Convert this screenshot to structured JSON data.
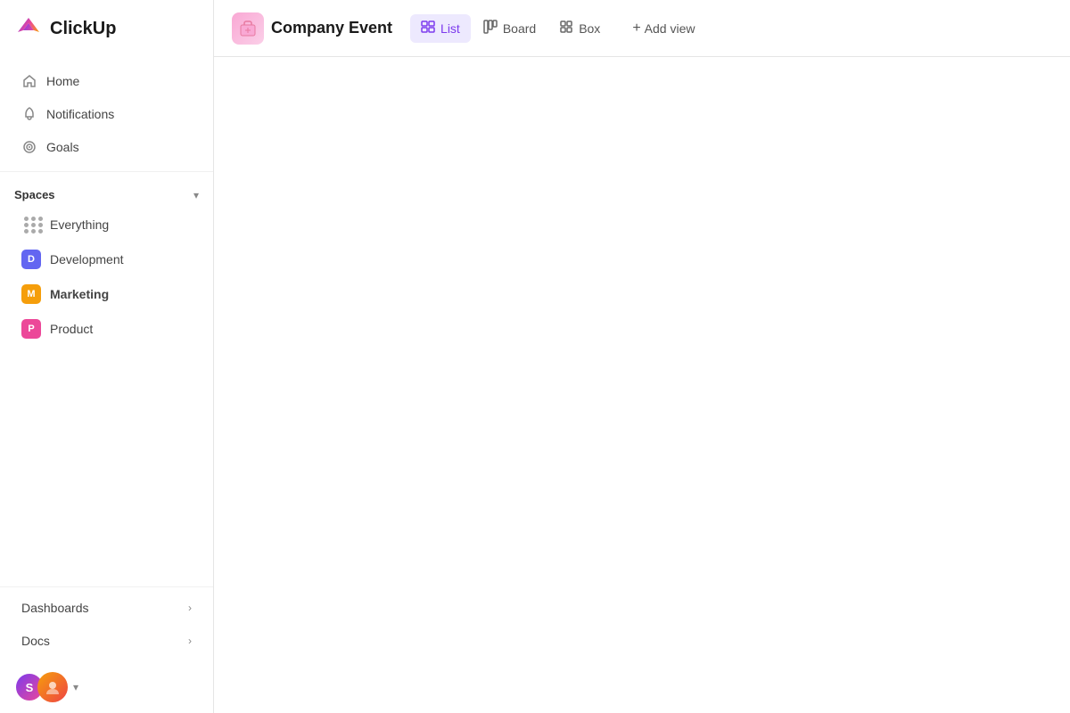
{
  "app": {
    "name": "ClickUp"
  },
  "sidebar": {
    "nav": [
      {
        "id": "home",
        "label": "Home",
        "icon": "home"
      },
      {
        "id": "notifications",
        "label": "Notifications",
        "icon": "bell"
      },
      {
        "id": "goals",
        "label": "Goals",
        "icon": "target"
      }
    ],
    "spaces_section": {
      "title": "Spaces",
      "items": [
        {
          "id": "everything",
          "label": "Everything",
          "type": "dots"
        },
        {
          "id": "development",
          "label": "Development",
          "type": "avatar",
          "letter": "D",
          "color": "#6366f1"
        },
        {
          "id": "marketing",
          "label": "Marketing",
          "type": "avatar",
          "letter": "M",
          "color": "#f59e0b",
          "bold": true
        },
        {
          "id": "product",
          "label": "Product",
          "type": "avatar",
          "letter": "P",
          "color": "#ec4899"
        }
      ]
    },
    "bottom_items": [
      {
        "id": "dashboards",
        "label": "Dashboards"
      },
      {
        "id": "docs",
        "label": "Docs"
      }
    ]
  },
  "header": {
    "project_title": "Company Event",
    "views": [
      {
        "id": "list",
        "label": "List",
        "active": true,
        "icon": "list"
      },
      {
        "id": "board",
        "label": "Board",
        "active": false,
        "icon": "board"
      },
      {
        "id": "box",
        "label": "Box",
        "active": false,
        "icon": "box"
      }
    ],
    "add_view_label": "Add view"
  }
}
